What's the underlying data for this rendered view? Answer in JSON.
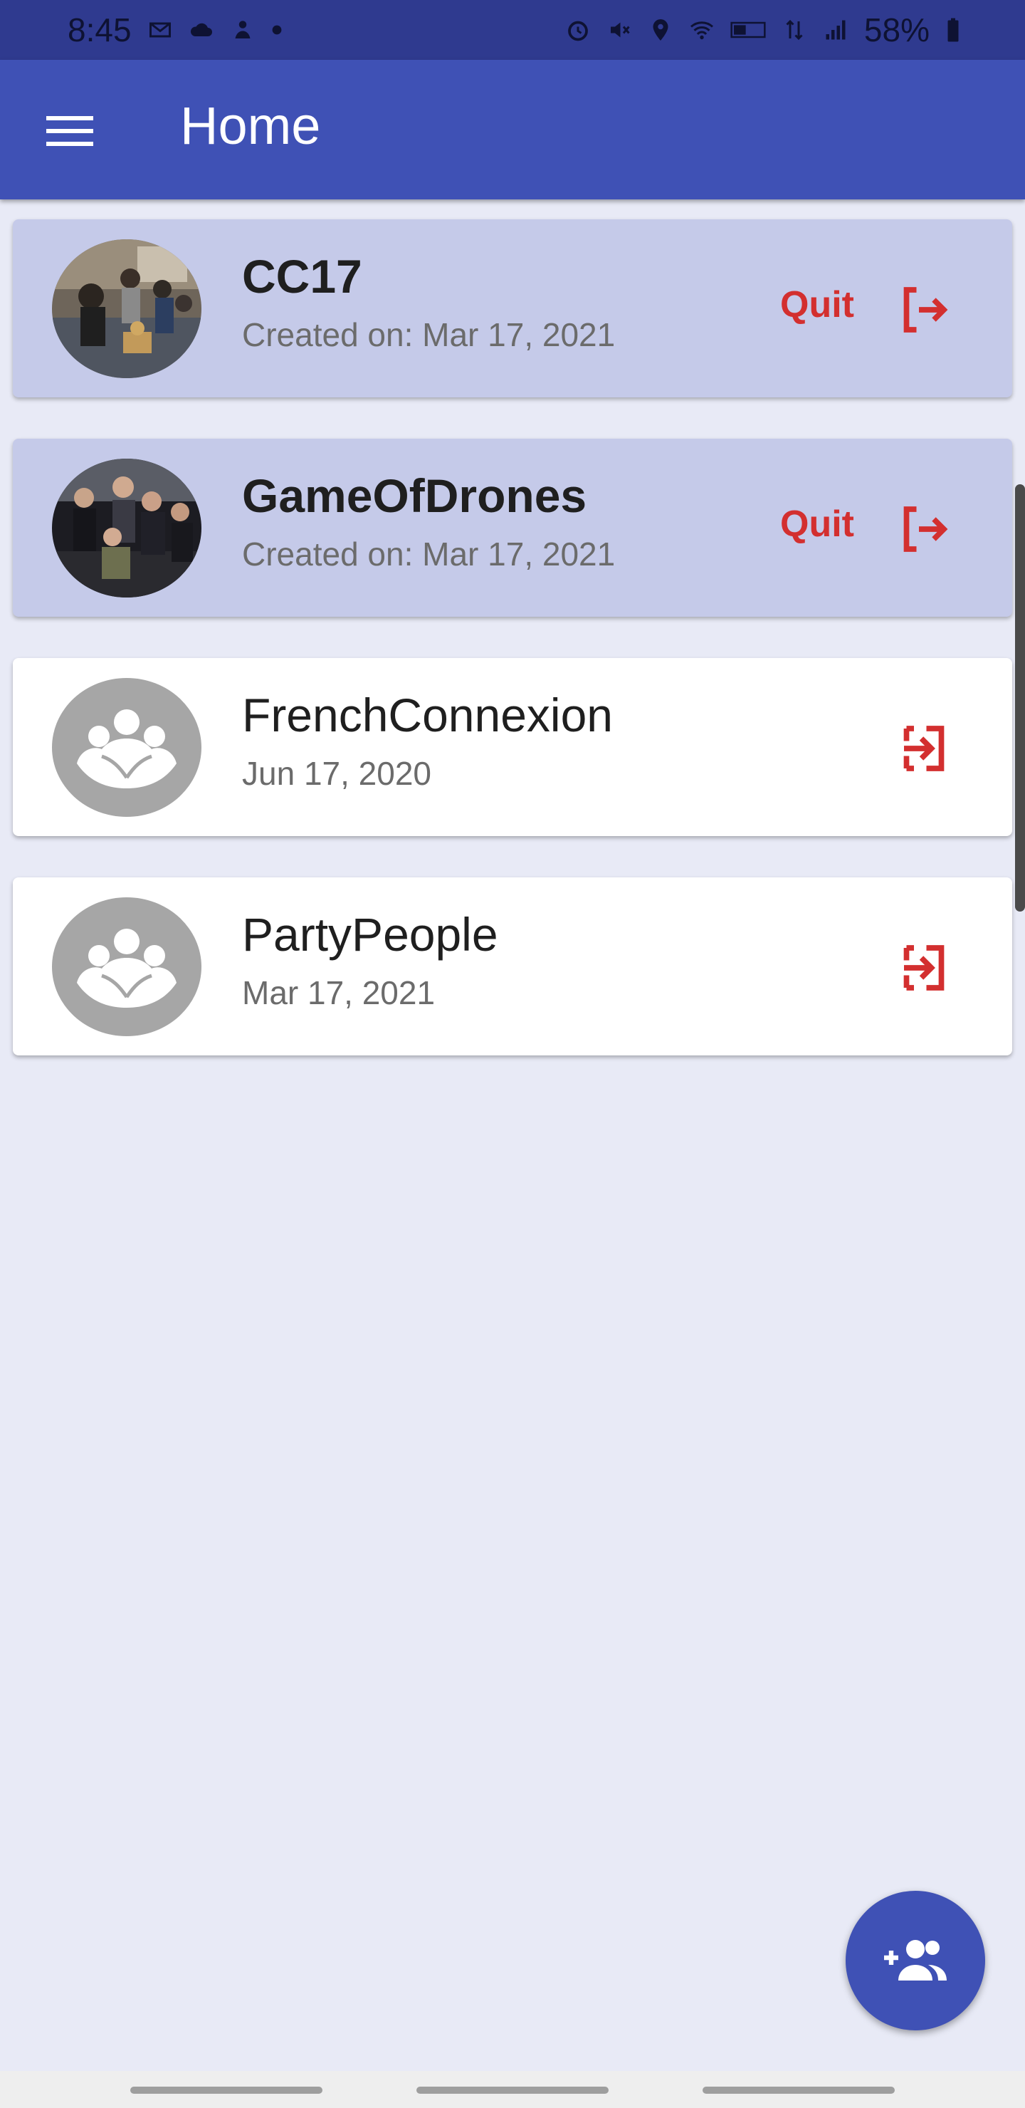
{
  "status_bar": {
    "time": "8:45",
    "battery": "58%",
    "left_icons": [
      "gmail-icon",
      "cloud-icon",
      "assistant-icon",
      "dot-icon"
    ],
    "right_icons": [
      "alarm-icon",
      "mute-icon",
      "location-icon",
      "wifi-icon",
      "volte-icon",
      "4g-icon",
      "signal-icon",
      "battery-icon"
    ]
  },
  "app_bar": {
    "title": "Home",
    "menu_icon": "menu-icon"
  },
  "groups": [
    {
      "name": "CC17",
      "date": "Created on: Mar 17, 2021",
      "status": "joined",
      "action_label": "Quit",
      "action_icon": "logout-icon",
      "avatar": "photo"
    },
    {
      "name": "GameOfDrones",
      "date": "Created on: Mar 17, 2021",
      "status": "joined",
      "action_label": "Quit",
      "action_icon": "logout-icon",
      "avatar": "photo"
    },
    {
      "name": "FrenchConnexion",
      "date": "Jun 17, 2020",
      "status": "available",
      "action_icon": "login-icon",
      "avatar": "group-placeholder-icon"
    },
    {
      "name": "PartyPeople",
      "date": "Mar 17, 2021",
      "status": "available",
      "action_icon": "login-icon",
      "avatar": "group-placeholder-icon"
    }
  ],
  "fab": {
    "icon": "add-group-icon"
  },
  "colors": {
    "primary": "#3f51b5",
    "status_bar": "#2f3a8f",
    "joined_card": "#c5cae9",
    "background": "#e8eaf6",
    "accent_red": "#d32f2f"
  }
}
